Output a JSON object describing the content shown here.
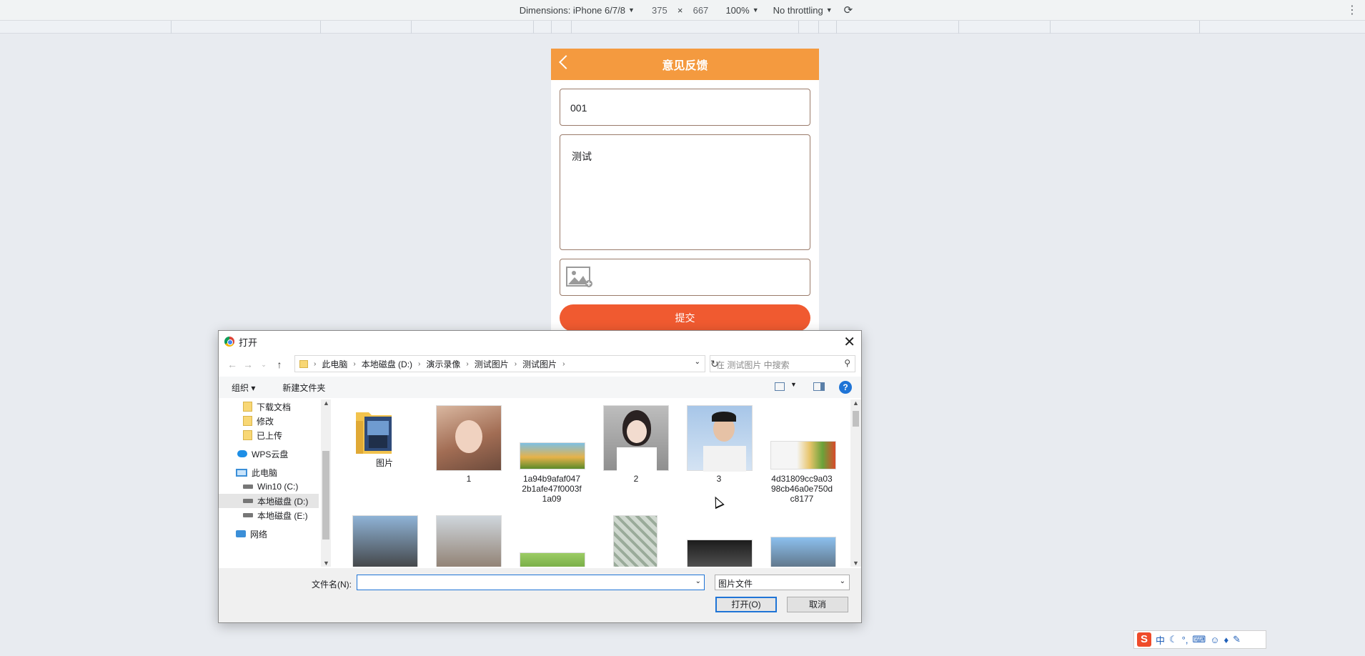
{
  "devtools": {
    "dimensions_label": "Dimensions: iPhone 6/7/8",
    "width": "375",
    "times": "×",
    "height": "667",
    "zoom": "100%",
    "throttling": "No throttling",
    "more": "⋮"
  },
  "phone": {
    "title": "意见反馈",
    "input_value": "001",
    "textarea_value": "测试",
    "submit_label": "提交"
  },
  "dialog": {
    "title": "打开",
    "close": "✕",
    "breadcrumb": [
      "此电脑",
      "本地磁盘 (D:)",
      "演示录像",
      "测试图片",
      "测试图片"
    ],
    "search_placeholder": "在 测试图片 中搜索",
    "organize": "组织 ▾",
    "new_folder": "新建文件夹",
    "help": "?",
    "nav_items": [
      {
        "label": "下载文档",
        "icon": "folder-icon"
      },
      {
        "label": "修改",
        "icon": "folder-icon"
      },
      {
        "label": "已上传",
        "icon": "folder-icon"
      },
      {
        "label": "WPS云盘",
        "icon": "cloud-icon"
      },
      {
        "label": "此电脑",
        "icon": "computer-icon"
      },
      {
        "label": "Win10 (C:)",
        "icon": "drive-icon"
      },
      {
        "label": "本地磁盘 (D:)",
        "icon": "drive-icon"
      },
      {
        "label": "本地磁盘 (E:)",
        "icon": "drive-icon"
      },
      {
        "label": "网络",
        "icon": "network-icon"
      }
    ],
    "files": [
      {
        "label": "图片",
        "kind": "folder"
      },
      {
        "label": "1",
        "kind": "image"
      },
      {
        "label": "1a94b9afaf0472b1afe47f0003f1a09",
        "kind": "image"
      },
      {
        "label": "2",
        "kind": "image"
      },
      {
        "label": "3",
        "kind": "image"
      },
      {
        "label": "4d31809cc9a0398cb46a0e750dc8177",
        "kind": "image"
      }
    ],
    "file_lines": {
      "f3": [
        "1a94b9afaf047",
        "2b1afe47f0003f",
        "1a09"
      ],
      "f6": [
        "4d31809cc9a03",
        "98cb46a0e750d",
        "c8177"
      ]
    },
    "filename_label": "文件名(N):",
    "filename_value": "",
    "filetype": "图片文件",
    "open_label": "打开(O)",
    "cancel_label": "取消"
  },
  "ime": {
    "mode": "中"
  }
}
